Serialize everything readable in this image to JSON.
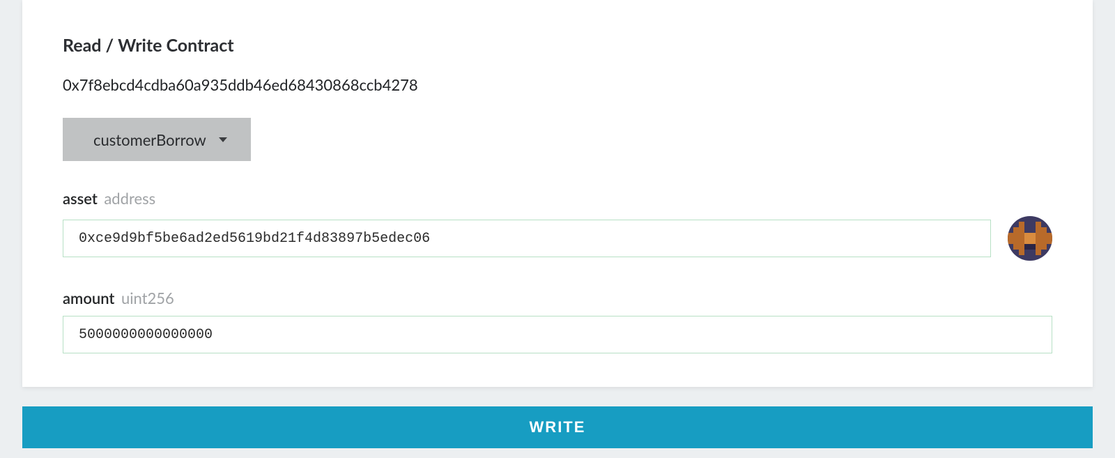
{
  "card": {
    "title": "Read / Write Contract",
    "contract_address": "0x7f8ebcd4cdba60a935ddb46ed68430868ccb4278"
  },
  "function_select": {
    "selected": "customerBorrow"
  },
  "fields": {
    "asset": {
      "name": "asset",
      "type": "address",
      "value": "0xce9d9bf5be6ad2ed5619bd21f4d83897b5edec06"
    },
    "amount": {
      "name": "amount",
      "type": "uint256",
      "value": "5000000000000000"
    }
  },
  "action": {
    "write_label": "WRITE"
  },
  "colors": {
    "primary": "#179dc2",
    "dropdown_bg": "#c0c2c3",
    "input_border": "#b7e0c5"
  }
}
